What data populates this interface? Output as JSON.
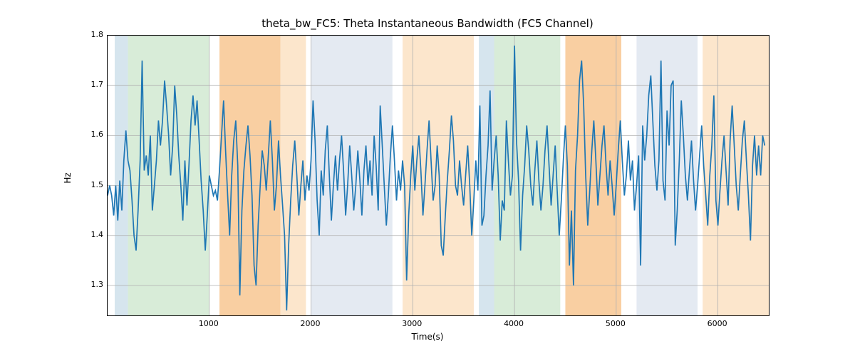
{
  "chart_data": {
    "type": "line",
    "title": "theta_bw_FC5: Theta Instantaneous Bandwidth (FC5 Channel)",
    "xlabel": "Time(s)",
    "ylabel": "Hz",
    "xlim": [
      0,
      6500
    ],
    "ylim": [
      1.24,
      1.8
    ],
    "x_ticks": [
      1000,
      2000,
      3000,
      4000,
      5000,
      6000
    ],
    "y_ticks": [
      1.3,
      1.4,
      1.5,
      1.6,
      1.7,
      1.8
    ],
    "shaded_bands": [
      {
        "x0": 70,
        "x1": 200,
        "color": "#d6e5ee"
      },
      {
        "x0": 200,
        "x1": 1000,
        "color": "#d8ecd8"
      },
      {
        "x0": 1100,
        "x1": 1700,
        "color": "#f9cfa2"
      },
      {
        "x0": 1700,
        "x1": 1950,
        "color": "#fce6cc"
      },
      {
        "x0": 2000,
        "x1": 2800,
        "color": "#e4eaf2"
      },
      {
        "x0": 2900,
        "x1": 3600,
        "color": "#fce6cc"
      },
      {
        "x0": 3650,
        "x1": 3800,
        "color": "#d6e5ee"
      },
      {
        "x0": 3800,
        "x1": 4450,
        "color": "#d8ecd8"
      },
      {
        "x0": 4500,
        "x1": 5050,
        "color": "#f9cfa2"
      },
      {
        "x0": 5200,
        "x1": 5800,
        "color": "#e4eaf2"
      },
      {
        "x0": 5850,
        "x1": 6500,
        "color": "#fce6cc"
      }
    ],
    "series": [
      {
        "name": "theta_bw_FC5",
        "color": "#1f77b4",
        "x_interval": 20,
        "x_start": 0,
        "values": [
          1.48,
          1.5,
          1.48,
          1.44,
          1.5,
          1.43,
          1.51,
          1.45,
          1.55,
          1.61,
          1.55,
          1.53,
          1.47,
          1.4,
          1.37,
          1.45,
          1.55,
          1.75,
          1.53,
          1.56,
          1.52,
          1.6,
          1.45,
          1.5,
          1.55,
          1.63,
          1.58,
          1.63,
          1.71,
          1.66,
          1.6,
          1.52,
          1.58,
          1.7,
          1.64,
          1.56,
          1.5,
          1.43,
          1.55,
          1.46,
          1.54,
          1.63,
          1.68,
          1.62,
          1.67,
          1.59,
          1.51,
          1.45,
          1.37,
          1.44,
          1.52,
          1.5,
          1.48,
          1.49,
          1.47,
          1.53,
          1.6,
          1.67,
          1.57,
          1.48,
          1.4,
          1.52,
          1.59,
          1.63,
          1.54,
          1.28,
          1.45,
          1.53,
          1.58,
          1.62,
          1.56,
          1.48,
          1.34,
          1.3,
          1.42,
          1.5,
          1.57,
          1.54,
          1.49,
          1.56,
          1.63,
          1.55,
          1.45,
          1.5,
          1.59,
          1.52,
          1.46,
          1.4,
          1.25,
          1.38,
          1.47,
          1.54,
          1.59,
          1.52,
          1.44,
          1.5,
          1.55,
          1.47,
          1.52,
          1.49,
          1.55,
          1.67,
          1.59,
          1.47,
          1.4,
          1.53,
          1.48,
          1.57,
          1.62,
          1.52,
          1.43,
          1.5,
          1.56,
          1.49,
          1.55,
          1.6,
          1.53,
          1.44,
          1.5,
          1.58,
          1.52,
          1.45,
          1.5,
          1.57,
          1.51,
          1.44,
          1.53,
          1.58,
          1.5,
          1.55,
          1.48,
          1.6,
          1.54,
          1.45,
          1.66,
          1.58,
          1.5,
          1.42,
          1.48,
          1.56,
          1.62,
          1.55,
          1.47,
          1.53,
          1.49,
          1.55,
          1.5,
          1.31,
          1.44,
          1.52,
          1.58,
          1.49,
          1.55,
          1.6,
          1.53,
          1.44,
          1.5,
          1.57,
          1.63,
          1.55,
          1.47,
          1.5,
          1.58,
          1.52,
          1.38,
          1.36,
          1.44,
          1.51,
          1.57,
          1.64,
          1.59,
          1.5,
          1.48,
          1.55,
          1.5,
          1.46,
          1.52,
          1.58,
          1.5,
          1.4,
          1.47,
          1.55,
          1.49,
          1.66,
          1.42,
          1.44,
          1.52,
          1.58,
          1.69,
          1.49,
          1.55,
          1.6,
          1.52,
          1.39,
          1.47,
          1.45,
          1.63,
          1.55,
          1.48,
          1.52,
          1.78,
          1.59,
          1.51,
          1.37,
          1.48,
          1.54,
          1.62,
          1.57,
          1.5,
          1.46,
          1.53,
          1.59,
          1.51,
          1.45,
          1.5,
          1.57,
          1.62,
          1.54,
          1.46,
          1.52,
          1.58,
          1.49,
          1.4,
          1.47,
          1.55,
          1.62,
          1.54,
          1.34,
          1.45,
          1.3,
          1.53,
          1.6,
          1.71,
          1.75,
          1.66,
          1.52,
          1.42,
          1.49,
          1.57,
          1.63,
          1.55,
          1.46,
          1.52,
          1.58,
          1.62,
          1.54,
          1.48,
          1.55,
          1.5,
          1.44,
          1.5,
          1.57,
          1.63,
          1.55,
          1.48,
          1.52,
          1.59,
          1.51,
          1.55,
          1.45,
          1.5,
          1.56,
          1.34,
          1.62,
          1.55,
          1.6,
          1.68,
          1.72,
          1.63,
          1.54,
          1.49,
          1.55,
          1.75,
          1.51,
          1.47,
          1.65,
          1.58,
          1.7,
          1.71,
          1.38,
          1.45,
          1.55,
          1.67,
          1.6,
          1.52,
          1.47,
          1.53,
          1.59,
          1.51,
          1.45,
          1.5,
          1.56,
          1.62,
          1.54,
          1.48,
          1.42,
          1.52,
          1.58,
          1.68,
          1.47,
          1.42,
          1.49,
          1.55,
          1.6,
          1.53,
          1.46,
          1.59,
          1.66,
          1.58,
          1.5,
          1.45,
          1.52,
          1.59,
          1.63,
          1.55,
          1.48,
          1.39,
          1.54,
          1.6,
          1.52,
          1.58,
          1.52,
          1.6,
          1.58
        ]
      }
    ]
  }
}
